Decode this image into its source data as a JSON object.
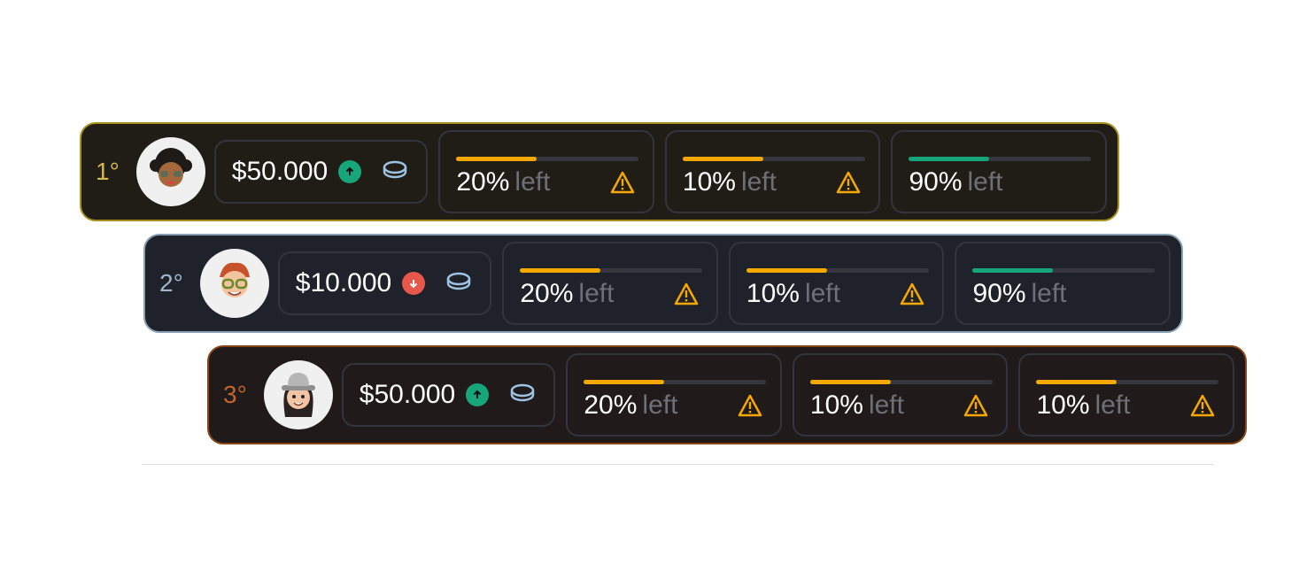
{
  "colors": {
    "gold": "#d4b84a",
    "silver": "#9fb8cc",
    "bronze": "#c0652a",
    "warning": "#f5a800",
    "progress_warn": "#f5a800",
    "progress_ok": "#17a57a",
    "up": "#17a57a",
    "down": "#e8574c",
    "coin": "#9ec3e2"
  },
  "rows": [
    {
      "rank": "1°",
      "amount": "$50.000",
      "trend": "up",
      "stats": [
        {
          "value": "20%",
          "suffix": "left",
          "fill": 0.44,
          "color": "warn",
          "warning": true
        },
        {
          "value": "10%",
          "suffix": "left",
          "fill": 0.44,
          "color": "warn",
          "warning": true
        },
        {
          "value": "90%",
          "suffix": "left",
          "fill": 0.44,
          "color": "ok",
          "warning": false
        }
      ]
    },
    {
      "rank": "2°",
      "amount": "$10.000",
      "trend": "down",
      "stats": [
        {
          "value": "20%",
          "suffix": "left",
          "fill": 0.44,
          "color": "warn",
          "warning": true
        },
        {
          "value": "10%",
          "suffix": "left",
          "fill": 0.44,
          "color": "warn",
          "warning": true
        },
        {
          "value": "90%",
          "suffix": "left",
          "fill": 0.44,
          "color": "ok",
          "warning": false
        }
      ]
    },
    {
      "rank": "3°",
      "amount": "$50.000",
      "trend": "up",
      "stats": [
        {
          "value": "20%",
          "suffix": "left",
          "fill": 0.44,
          "color": "warn",
          "warning": true
        },
        {
          "value": "10%",
          "suffix": "left",
          "fill": 0.44,
          "color": "warn",
          "warning": true
        },
        {
          "value": "10%",
          "suffix": "left",
          "fill": 0.44,
          "color": "warn",
          "warning": true
        }
      ]
    }
  ],
  "icons": {
    "avatar": "avatar-icon",
    "trend_up": "arrow-up-icon",
    "trend_down": "arrow-down-icon",
    "coin": "coin-icon",
    "warning": "warning-icon"
  }
}
